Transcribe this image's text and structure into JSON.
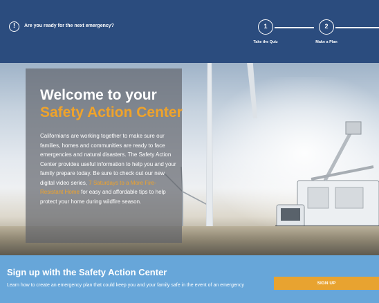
{
  "header": {
    "alert_icon_symbol": "!",
    "alert_text": "Are you ready for the next emergency?",
    "steps": [
      {
        "number": "1",
        "label": "Take the Quiz"
      },
      {
        "number": "2",
        "label": "Make a Plan"
      }
    ]
  },
  "hero": {
    "title": "Welcome to your",
    "subtitle": "Safety Action Center",
    "body_before_link": "Californians are working together to make sure our families, homes and communities are ready to face emergencies and natural disasters. The Safety Action Center provides useful information to help you and your family prepare today. Be sure to check out our new digital video series, ",
    "body_link": "7 Saturdays to a More Fire-Resistant Home",
    "body_after_link": " for easy and affordable tips to help protect your home during wildfire season."
  },
  "signup": {
    "title": "Sign up with the Safety Action Center",
    "description": "Learn how to create an emergency plan that could keep you and your family safe in the event of an emergency",
    "button_label": "SIGN UP"
  },
  "colors": {
    "header_bg": "#2b4c7e",
    "accent_orange": "#f0a32a",
    "signup_bg": "#67a6d9",
    "button_bg": "#e8a330"
  }
}
